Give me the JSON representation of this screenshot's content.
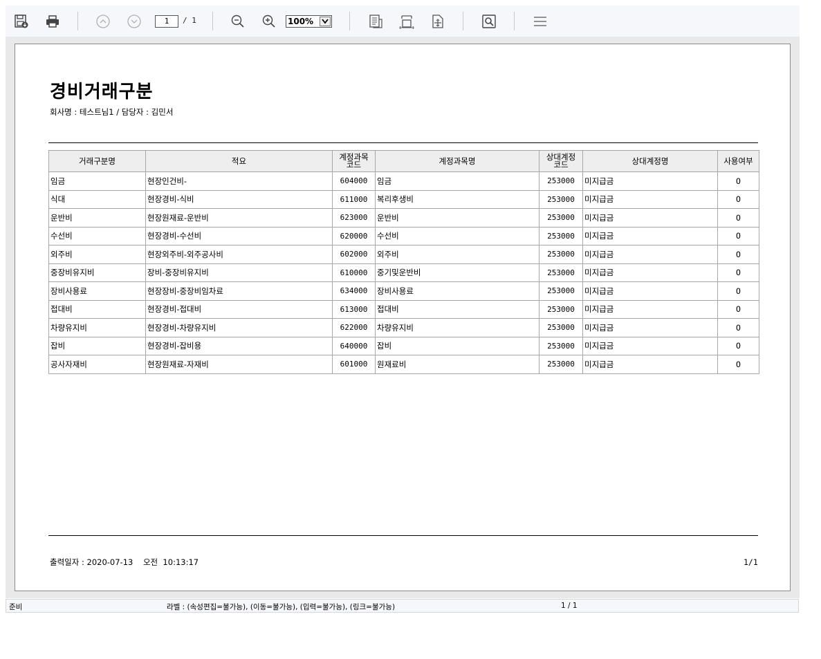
{
  "toolbar": {
    "page_current": "1",
    "page_total": "/ 1",
    "zoom": "100%",
    "buttons": [
      "save-icon",
      "print-icon",
      "prev-page-icon",
      "next-page-icon",
      "zoom-out-icon",
      "zoom-in-icon",
      "fit-page-icon",
      "fit-width-icon",
      "fit-original-icon",
      "find-icon",
      "menu-icon"
    ]
  },
  "document": {
    "title": "경비거래구분",
    "subtitle": "회사명 : 테스트님1 / 담당자 : 김민서",
    "columns": [
      "거래구분명",
      "적요",
      "계정과목\n코드",
      "계정과목명",
      "상대계정\n코드",
      "상대계정명",
      "사용여부"
    ],
    "rows": [
      [
        "임금",
        "현장인건비-",
        "604000",
        "임금",
        "253000",
        "미지급금",
        "O"
      ],
      [
        "식대",
        "현장경비-식비",
        "611000",
        "복리후생비",
        "253000",
        "미지급금",
        "O"
      ],
      [
        "운반비",
        "현장원재료-운반비",
        "623000",
        "운반비",
        "253000",
        "미지급금",
        "O"
      ],
      [
        "수선비",
        "현장경비-수선비",
        "620000",
        "수선비",
        "253000",
        "미지급금",
        "O"
      ],
      [
        "외주비",
        "현장외주비-외주공사비",
        "602000",
        "외주비",
        "253000",
        "미지급금",
        "O"
      ],
      [
        "중장비유지비",
        "장비-중장비유지비",
        "610000",
        "중기및운반비",
        "253000",
        "미지급금",
        "O"
      ],
      [
        "장비사용료",
        "현장장비-중장비임차료",
        "634000",
        "장비사용료",
        "253000",
        "미지급금",
        "O"
      ],
      [
        "접대비",
        "현장경비-접대비",
        "613000",
        "접대비",
        "253000",
        "미지급금",
        "O"
      ],
      [
        "차량유지비",
        "현장경비-차량유지비",
        "622000",
        "차량유지비",
        "253000",
        "미지급금",
        "O"
      ],
      [
        "잡비",
        "현장경비-잡비용",
        "640000",
        "잡비",
        "253000",
        "미지급금",
        "O"
      ],
      [
        "공사자재비",
        "현장원재료-자재비",
        "601000",
        "원재료비",
        "253000",
        "미지급금",
        "O"
      ]
    ],
    "footer_date": "출력일자 : 2020-07-13    오전  10:13:17",
    "footer_page": "1/1"
  },
  "status": {
    "state": "준비",
    "label_info": "라벨 : (속성편집=불가능), (이동=불가능), (입력=불가능), (링크=불가능)",
    "page": "1 / 1"
  }
}
